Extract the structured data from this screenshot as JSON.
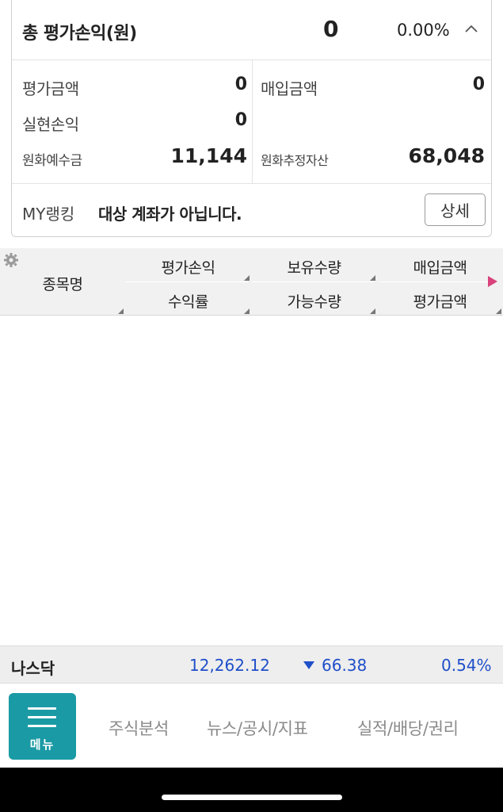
{
  "summary": {
    "title": "총 평가손익(원)",
    "total_value": "0",
    "total_rate": "0.00%",
    "eval_amount_label": "평가금액",
    "eval_amount_value": "0",
    "purchase_amount_label": "매입금액",
    "purchase_amount_value": "0",
    "realized_label": "실현손익",
    "realized_value": "0",
    "krw_deposit_label": "원화예수금",
    "krw_deposit_value": "11,144",
    "krw_est_assets_label": "원화추정자산",
    "krw_est_assets_value": "68,048"
  },
  "ranking": {
    "label": "MY랭킹",
    "text": "대상 계좌가 아닙니다.",
    "detail_button": "상세"
  },
  "table": {
    "name_header": "종목명",
    "headers_top": [
      "평가손익",
      "보유수량",
      "매입금액"
    ],
    "headers_bottom": [
      "수익률",
      "가능수량",
      "평가금액"
    ]
  },
  "ticker": {
    "name": "나스닥",
    "price": "12,262.12",
    "change": "66.38",
    "rate": "0.54%",
    "direction": "down",
    "color": "#1f4fc9"
  },
  "bottom_nav": {
    "menu_label": "메뉴",
    "items": [
      "주식분석",
      "뉴스/공시/지표",
      "실적/배당/권리"
    ],
    "accent": "#1a9aa4"
  }
}
